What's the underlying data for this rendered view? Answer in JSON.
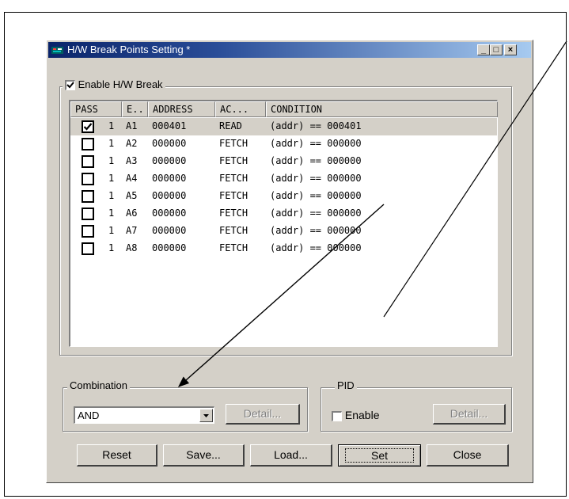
{
  "dialog": {
    "title": "H/W Break Points Setting *",
    "minimize": "_",
    "maximize": "□",
    "close": "×"
  },
  "enable_break": {
    "label": "Enable H/W Break",
    "checked": true
  },
  "table": {
    "columns": [
      "PASS",
      "E..",
      "ADDRESS",
      "AC...",
      "CONDITION"
    ],
    "rows": [
      {
        "checked": true,
        "pass": "1",
        "e": "A1",
        "address": "000401",
        "access": "READ",
        "condition": "(addr) == 000401",
        "selected": true
      },
      {
        "checked": false,
        "pass": "1",
        "e": "A2",
        "address": "000000",
        "access": "FETCH",
        "condition": "(addr) == 000000"
      },
      {
        "checked": false,
        "pass": "1",
        "e": "A3",
        "address": "000000",
        "access": "FETCH",
        "condition": "(addr) == 000000"
      },
      {
        "checked": false,
        "pass": "1",
        "e": "A4",
        "address": "000000",
        "access": "FETCH",
        "condition": "(addr) == 000000"
      },
      {
        "checked": false,
        "pass": "1",
        "e": "A5",
        "address": "000000",
        "access": "FETCH",
        "condition": "(addr) == 000000"
      },
      {
        "checked": false,
        "pass": "1",
        "e": "A6",
        "address": "000000",
        "access": "FETCH",
        "condition": "(addr) == 000000"
      },
      {
        "checked": false,
        "pass": "1",
        "e": "A7",
        "address": "000000",
        "access": "FETCH",
        "condition": "(addr) == 000000"
      },
      {
        "checked": false,
        "pass": "1",
        "e": "A8",
        "address": "000000",
        "access": "FETCH",
        "condition": "(addr) == 000000"
      }
    ]
  },
  "combination": {
    "label": "Combination",
    "value": "AND",
    "detail": "Detail..."
  },
  "pid": {
    "label": "PID",
    "enable_label": "Enable",
    "checked": false,
    "detail": "Detail..."
  },
  "buttons": {
    "reset": "Reset",
    "save": "Save...",
    "load": "Load...",
    "set": "Set",
    "close": "Close"
  }
}
